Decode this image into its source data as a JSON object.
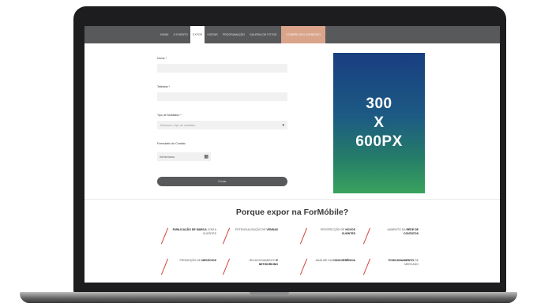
{
  "nav": {
    "items": [
      "Home",
      "O Evento",
      "Expor",
      "Visitar",
      "Programação",
      "Galeria de Fotos"
    ],
    "active_index": 2,
    "cta_label": "Compre seu Ingresso"
  },
  "form": {
    "name_label": "Nome *",
    "phone_label": "Telefone *",
    "type_label": "Tipo de Mobiliário *",
    "type_placeholder": "Selecione o tipo de mobiliário",
    "date_label": "Formulário de Contato",
    "date_value": "dd/mm/aaaa",
    "submit_label": "Enviar"
  },
  "ad": {
    "line1": "300",
    "line2": "X",
    "line3": "600PX"
  },
  "why": {
    "title": "Porque expor na ForMóbile?",
    "benefits": [
      {
        "lead": "",
        "bold": "Publicação de marca",
        "tail": "com a clientes"
      },
      {
        "lead": "Potencialização de",
        "bold": "vendas",
        "tail": ""
      },
      {
        "lead": "Prospecção de",
        "bold": "novos clientes",
        "tail": ""
      },
      {
        "lead": "Aumento da",
        "bold": "rede de contatos",
        "tail": ""
      },
      {
        "lead": "Promoção de",
        "bold": "negócios",
        "tail": ""
      },
      {
        "lead": "Relacionamento",
        "bold": "e networking",
        "tail": ""
      },
      {
        "lead": "Análise da",
        "bold": "concorrência",
        "tail": ""
      },
      {
        "lead": "",
        "bold": "Posicionamento",
        "tail": "de mercado"
      }
    ]
  },
  "colors": {
    "nav_bg": "#58595b",
    "cta": "#d9a48a",
    "accent_slash": "#d0453c",
    "ad_top": "#183e80",
    "ad_bottom": "#39a35e"
  }
}
